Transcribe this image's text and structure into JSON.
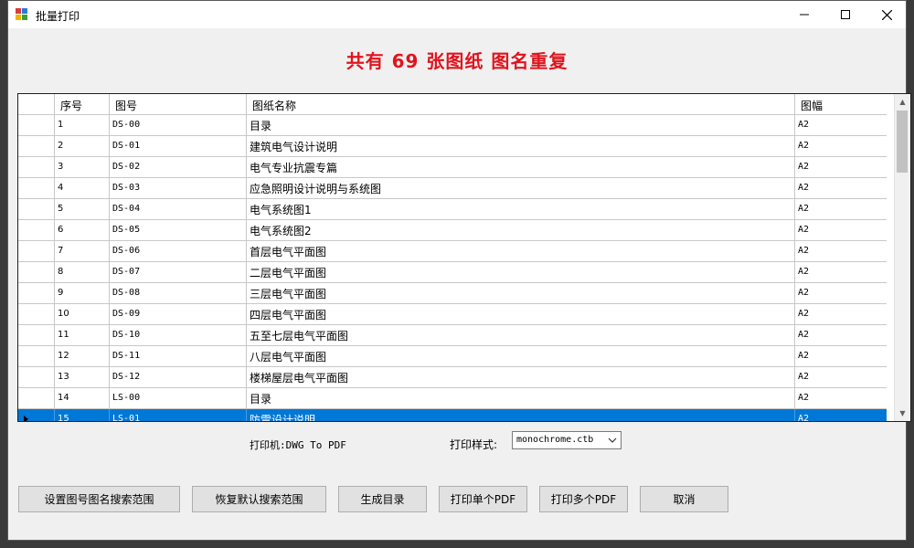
{
  "window": {
    "title": "批量打印",
    "controls": {
      "minimize": "minimize-icon",
      "maximize": "maximize-icon",
      "close": "close-icon"
    }
  },
  "headline": "共有 69 张图纸  图名重复",
  "table": {
    "columns": [
      "",
      "序号",
      "图号",
      "图纸名称",
      "图幅"
    ],
    "rows": [
      {
        "no": "1",
        "code": "DS-00",
        "name": "目录",
        "size": "A2"
      },
      {
        "no": "2",
        "code": "DS-01",
        "name": "建筑电气设计说明",
        "size": "A2"
      },
      {
        "no": "3",
        "code": "DS-02",
        "name": "电气专业抗震专篇",
        "size": "A2"
      },
      {
        "no": "4",
        "code": "DS-03",
        "name": "应急照明设计说明与系统图",
        "size": "A2"
      },
      {
        "no": "5",
        "code": "DS-04",
        "name": "电气系统图1",
        "size": "A2"
      },
      {
        "no": "6",
        "code": "DS-05",
        "name": "电气系统图2",
        "size": "A2"
      },
      {
        "no": "7",
        "code": "DS-06",
        "name": "首层电气平面图",
        "size": "A2"
      },
      {
        "no": "8",
        "code": "DS-07",
        "name": "二层电气平面图",
        "size": "A2"
      },
      {
        "no": "9",
        "code": "DS-08",
        "name": "三层电气平面图",
        "size": "A2"
      },
      {
        "no": "10",
        "code": "DS-09",
        "name": "四层电气平面图",
        "size": "A2"
      },
      {
        "no": "11",
        "code": "DS-10",
        "name": "五至七层电气平面图",
        "size": "A2"
      },
      {
        "no": "12",
        "code": "DS-11",
        "name": "八层电气平面图",
        "size": "A2"
      },
      {
        "no": "13",
        "code": "DS-12",
        "name": "楼梯屋层电气平面图",
        "size": "A2"
      },
      {
        "no": "14",
        "code": "LS-00",
        "name": "目录",
        "size": "A2"
      },
      {
        "no": "15",
        "code": "LS-01",
        "name": "防雷设计说明",
        "size": "A2",
        "selected": true
      }
    ]
  },
  "printer": {
    "label": "打印机:DWG To PDF"
  },
  "print_style": {
    "label": "打印样式:",
    "value": "monochrome.ctb"
  },
  "buttons": {
    "set_range": "设置图号图名搜索范围",
    "restore_range": "恢复默认搜索范围",
    "generate_toc": "生成目录",
    "print_single": "打印单个PDF",
    "print_multi": "打印多个PDF",
    "cancel": "取消"
  },
  "colors": {
    "headline": "#e0141e",
    "selection": "#0078d7"
  }
}
